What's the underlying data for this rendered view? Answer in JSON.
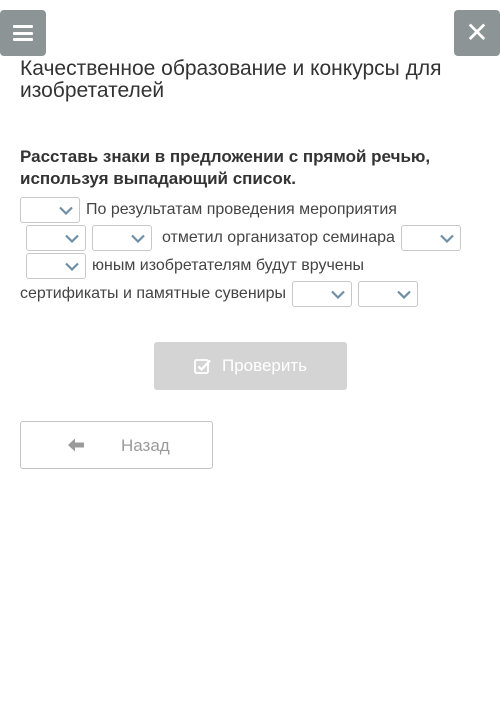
{
  "header": {
    "menu_icon": "hamburger-menu-icon",
    "close_icon": "close-icon",
    "title": "Качественное образование и конкурсы для изобретателей"
  },
  "task": {
    "instruction": "Расставь знаки в предложении с прямой речью, используя выпадающий список."
  },
  "exercise": {
    "dropdown_icon": "chevron-down-icon",
    "text_1": "По результатам проведения мероприятия",
    "text_2": "отметил организатор семинара",
    "text_3": "юным изобретателям будут вручены",
    "text_4": "сертификаты и памятные сувениры"
  },
  "buttons": {
    "check_label": "Проверить",
    "check_icon": "checkbox-edit-icon",
    "back_label": "Назад",
    "back_icon": "arrow-left-icon"
  },
  "colors": {
    "topbar_button": "#8c9495",
    "check_button_disabled": "#d4d4d4",
    "dropdown_chevron": "#6f8fa6"
  }
}
